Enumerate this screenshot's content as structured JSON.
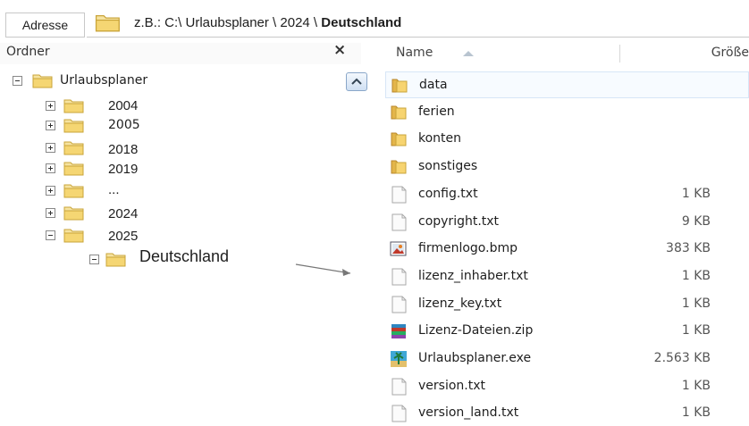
{
  "address": {
    "label": "Adresse",
    "path_prefix": "z.B.:  C:\\ Urlaubsplaner \\ 2024 \\ ",
    "path_bold": "Deutschland"
  },
  "folders_pane": {
    "title": "Ordner",
    "close_glyph": "×",
    "tree": [
      {
        "label": "Urlaubsplaner",
        "state": "expanded"
      },
      {
        "label": "2004",
        "state": "collapsed"
      },
      {
        "label": "2005",
        "state": "collapsed"
      },
      {
        "label": "2018",
        "state": "collapsed"
      },
      {
        "label": "2019",
        "state": "collapsed"
      },
      {
        "label": "...",
        "state": "collapsed"
      },
      {
        "label": "2024",
        "state": "collapsed"
      },
      {
        "label": "2025",
        "state": "expanded"
      },
      {
        "label": "Deutschland",
        "state": "expanded"
      }
    ]
  },
  "files_pane": {
    "col_name": "Name",
    "col_size": "Größe",
    "files": [
      {
        "name": "data",
        "size": "",
        "icon": "folder-icon",
        "selected": true
      },
      {
        "name": "ferien",
        "size": "",
        "icon": "folder-icon"
      },
      {
        "name": "konten",
        "size": "",
        "icon": "folder-icon"
      },
      {
        "name": "sonstiges",
        "size": "",
        "icon": "folder-icon"
      },
      {
        "name": "config.txt",
        "size": "1 KB",
        "icon": "text-file-icon"
      },
      {
        "name": "copyright.txt",
        "size": "9 KB",
        "icon": "text-file-icon"
      },
      {
        "name": "firmenlogo.bmp",
        "size": "383 KB",
        "icon": "image-file-icon"
      },
      {
        "name": "lizenz_inhaber.txt",
        "size": "1 KB",
        "icon": "text-file-icon"
      },
      {
        "name": "lizenz_key.txt",
        "size": "1 KB",
        "icon": "text-file-icon"
      },
      {
        "name": "Lizenz-Dateien.zip",
        "size": "1 KB",
        "icon": "archive-file-icon"
      },
      {
        "name": "Urlaubsplaner.exe",
        "size": "2.563 KB",
        "icon": "app-exe-icon"
      },
      {
        "name": "version.txt",
        "size": "1 KB",
        "icon": "text-file-icon"
      },
      {
        "name": "version_land.txt",
        "size": "1 KB",
        "icon": "text-file-icon"
      }
    ]
  },
  "colors": {
    "folder_yellow": "#f5d673",
    "folder_edge": "#c9a43a",
    "selection": "#d7e6f7",
    "border": "#c8c8c8"
  }
}
